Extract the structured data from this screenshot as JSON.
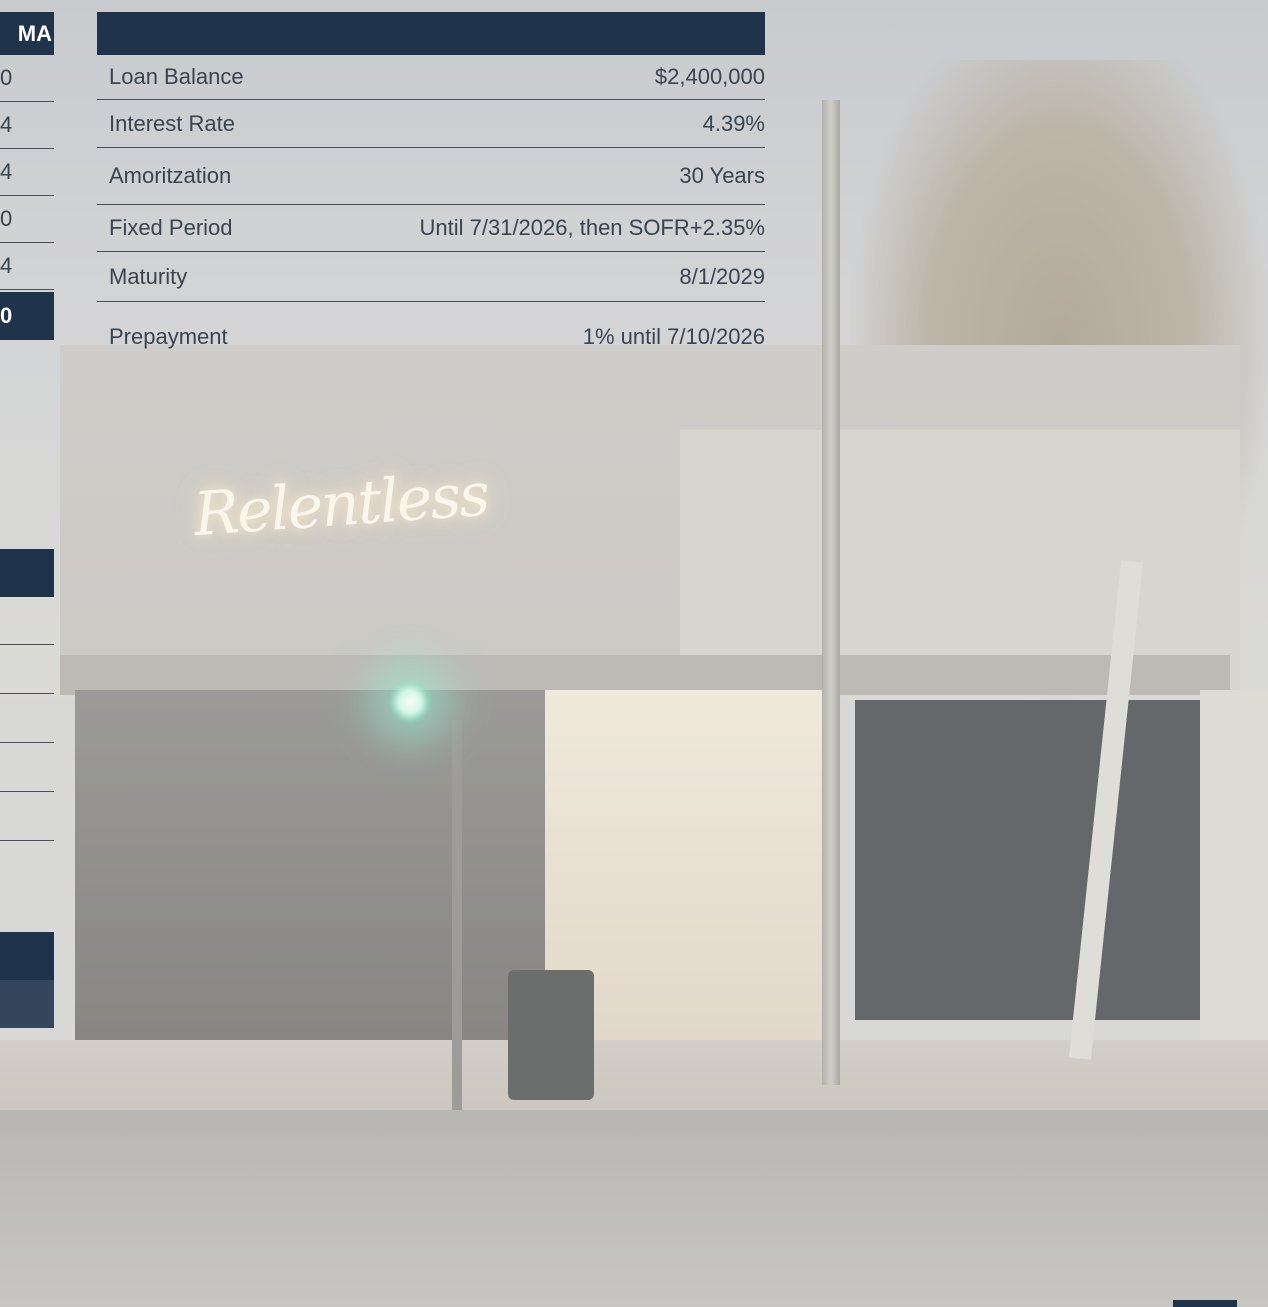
{
  "loan_terms": {
    "rows": [
      {
        "label": "Loan Balance",
        "value": "$2,400,000"
      },
      {
        "label": "Interest Rate",
        "value": "4.39%"
      },
      {
        "label": "Amoritzation",
        "value": "30 Years"
      },
      {
        "label": "Fixed Period",
        "value": "Until 7/31/2026, then SOFR+2.35%"
      },
      {
        "label": "Maturity",
        "value": "8/1/2029"
      },
      {
        "label": "Prepayment",
        "value": "1% until 7/10/2026"
      }
    ]
  },
  "left_panel": {
    "header": "MA",
    "cells": [
      "0",
      "4",
      "4",
      "0",
      "4"
    ],
    "total": "0"
  },
  "photo": {
    "sign_text": "Relentless"
  },
  "colors": {
    "navy": "#1f344a",
    "text": "#3a4350",
    "rule": "#4a4f57"
  }
}
